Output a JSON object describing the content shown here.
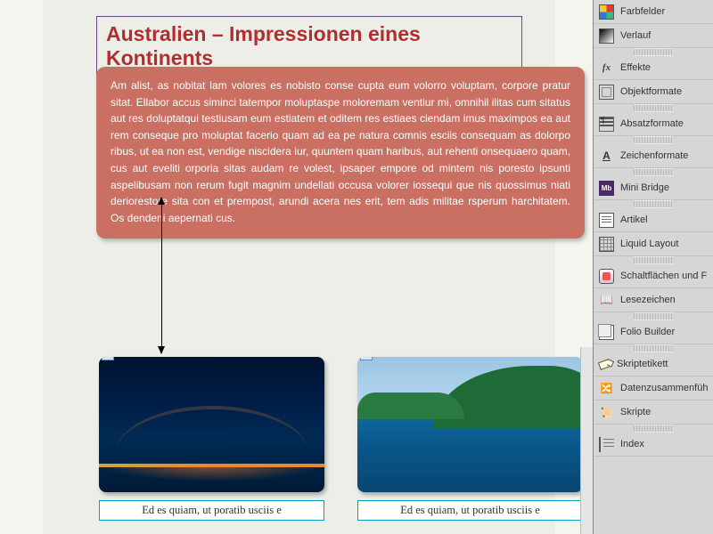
{
  "document": {
    "title": "Australien – Impressionen eines Kontinents",
    "body_text": "Am alist, as nobitat lam volores es nobisto conse cupta eum volorro voluptam, corpore pratur sitat. Ellabor accus siminci tatempor moluptaspe moloremam ventiur mi, omnihil ilitas cum sitatus aut res doluptatqui testiusam eum estiatem et oditem res estiaes ciendam imus maximpos ea aut rem conseque pro moluptat facerio quam ad ea pe natura comnis esciis consequam as dolorpo ribus, ut ea non est, vendige niscidera iur, quuntem quam haribus, aut rehenti onsequaero quam, cus aut eveliti orporia sitas audam re volest, ipsaper empore od mintem nis poresto ipsunti aspelibusam non rerum fugit magnim undellati occusa volorer iossequi que nis quossimus niati deriorestore sita con et prempost, arundi acera nes erit, tem adis militae rsperum harchitatem. Os dendeni aepernati cus.",
    "caption1": "Ed es quiam, ut poratib usciis e",
    "caption2": "Ed es quiam, ut poratib usciis e"
  },
  "panels": {
    "farbfelder": "Farbfelder",
    "verlauf": "Verlauf",
    "effekte": "Effekte",
    "objektformate": "Objektformate",
    "absatzformate": "Absatzformate",
    "zeichenformate": "Zeichenformate",
    "minibridge": "Mini Bridge",
    "artikel": "Artikel",
    "liquidlayout": "Liquid Layout",
    "schaltflaechen": "Schaltflächen und F",
    "lesezeichen": "Lesezeichen",
    "foliobuilder": "Folio Builder",
    "skriptetikett": "Skriptetikett",
    "daten": "Datenzusammenfüh",
    "skripte": "Skripte",
    "index": "Index",
    "fx_label": "fx",
    "char_label": "A",
    "mb_label": "Mb"
  }
}
